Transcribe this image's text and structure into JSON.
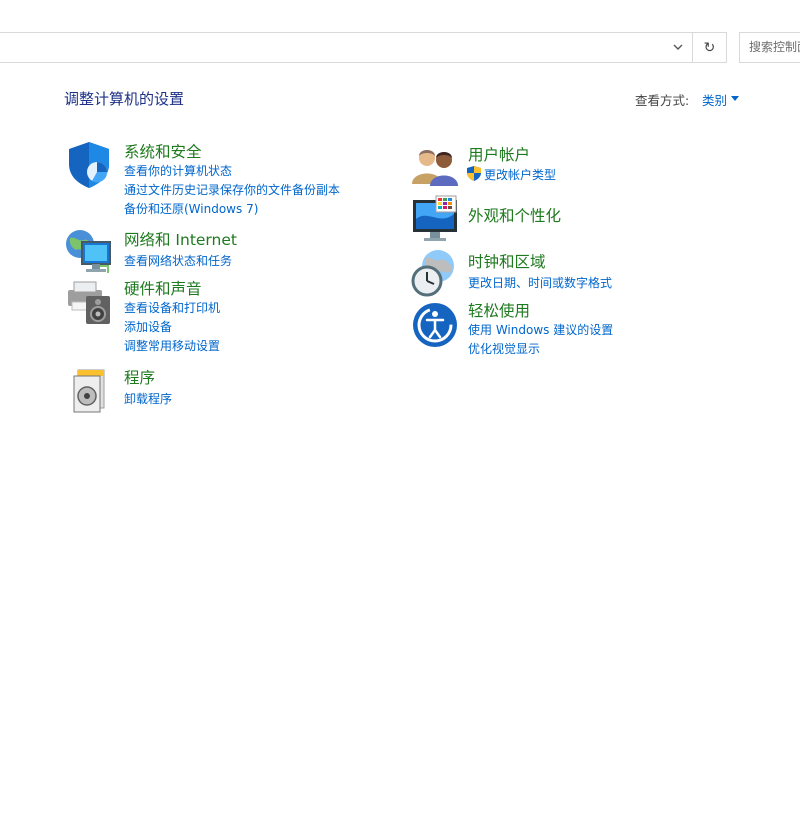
{
  "address_bar": {
    "refresh_glyph": "↻"
  },
  "search": {
    "placeholder": "搜索控制面板"
  },
  "page": {
    "title": "调整计算机的设置"
  },
  "view_by": {
    "label": "查看方式:",
    "value": "类别"
  },
  "categories_left": [
    {
      "icon": "system-security-icon",
      "title": "系统和安全",
      "links": [
        "查看你的计算机状态",
        "通过文件历史记录保存你的文件备份副本",
        "备份和还原(Windows 7)"
      ]
    },
    {
      "icon": "network-internet-icon",
      "title": "网络和 Internet",
      "links": [
        "查看网络状态和任务"
      ]
    },
    {
      "icon": "hardware-sound-icon",
      "title": "硬件和声音",
      "links": [
        "查看设备和打印机",
        "添加设备",
        "调整常用移动设置"
      ]
    },
    {
      "icon": "programs-icon",
      "title": "程序",
      "links": [
        "卸载程序"
      ]
    }
  ],
  "categories_right": [
    {
      "icon": "user-accounts-icon",
      "title": "用户帐户",
      "links": [
        "更改帐户类型"
      ]
    },
    {
      "icon": "appearance-personalization-icon",
      "title": "外观和个性化",
      "links": []
    },
    {
      "icon": "clock-region-icon",
      "title": "时钟和区域",
      "links": [
        "更改日期、时间或数字格式"
      ]
    },
    {
      "icon": "ease-of-access-icon",
      "title": "轻松使用",
      "links": [
        "使用 Windows 建议的设置",
        "优化视觉显示"
      ]
    }
  ],
  "colors": {
    "title_blue": "#1e3287",
    "link_blue": "#0066cc",
    "category_green": "#1e7a1e"
  }
}
